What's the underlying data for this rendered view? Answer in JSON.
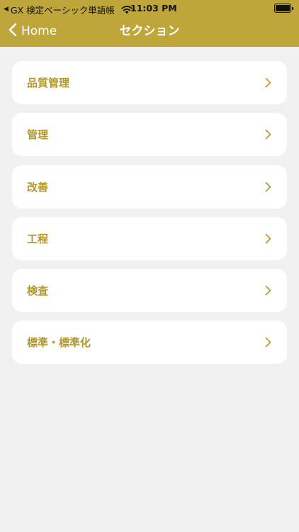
{
  "status_bar": {
    "back_app": "GX 検定ベーシック単語帳",
    "time": "11:03 PM"
  },
  "nav": {
    "back_label": "Home",
    "title": "セクション"
  },
  "sections": [
    {
      "label": "品質管理"
    },
    {
      "label": "管理"
    },
    {
      "label": "改善"
    },
    {
      "label": "工程"
    },
    {
      "label": "検査"
    },
    {
      "label": "標準・標準化"
    }
  ],
  "colors": {
    "accent": "#bfa63a",
    "label_text": "#b5982a",
    "background": "#f1f1f1",
    "card": "#ffffff"
  },
  "icons": {
    "back": "chevron-left-icon",
    "row": "chevron-right-icon",
    "wifi": "wifi-icon",
    "battery": "battery-icon"
  }
}
